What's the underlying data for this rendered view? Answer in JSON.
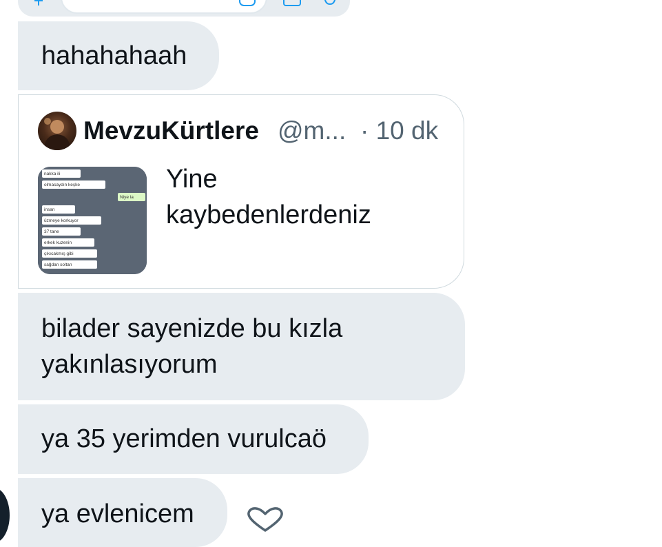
{
  "colors": {
    "bubble_background": "#e7ecf0",
    "card_border": "#cfd9de",
    "text_primary": "#0f1419",
    "text_secondary": "#536471"
  },
  "composer": {
    "icons": [
      "plus-icon",
      "gif-icon",
      "image-icon",
      "mic-icon"
    ]
  },
  "messages": [
    {
      "lines": [
        "hahahahaah"
      ]
    },
    {
      "lines": [
        "bilader sayenizde bu kızla",
        "yakınlasıyorum"
      ]
    },
    {
      "lines": [
        "ya 35 yerimden vurulcaö"
      ]
    },
    {
      "lines": [
        "ya evlenicem"
      ]
    }
  ],
  "quoted_tweet": {
    "author_name": "MevzuKürtlere",
    "author_handle": "@m...",
    "time": "· 10 dk",
    "text_lines": [
      "Yine",
      "kaybedenlerdeniz"
    ],
    "media_chat_lines": [
      "nakka ili",
      "olmasaydın keşke",
      "Niye la",
      "insan",
      "üzmeye korkuyor",
      "37 tane",
      "erkek kuzenin",
      "çıkıcakmış gibi",
      "sağdan soltan"
    ]
  },
  "reaction": {
    "icon": "heart-icon"
  }
}
